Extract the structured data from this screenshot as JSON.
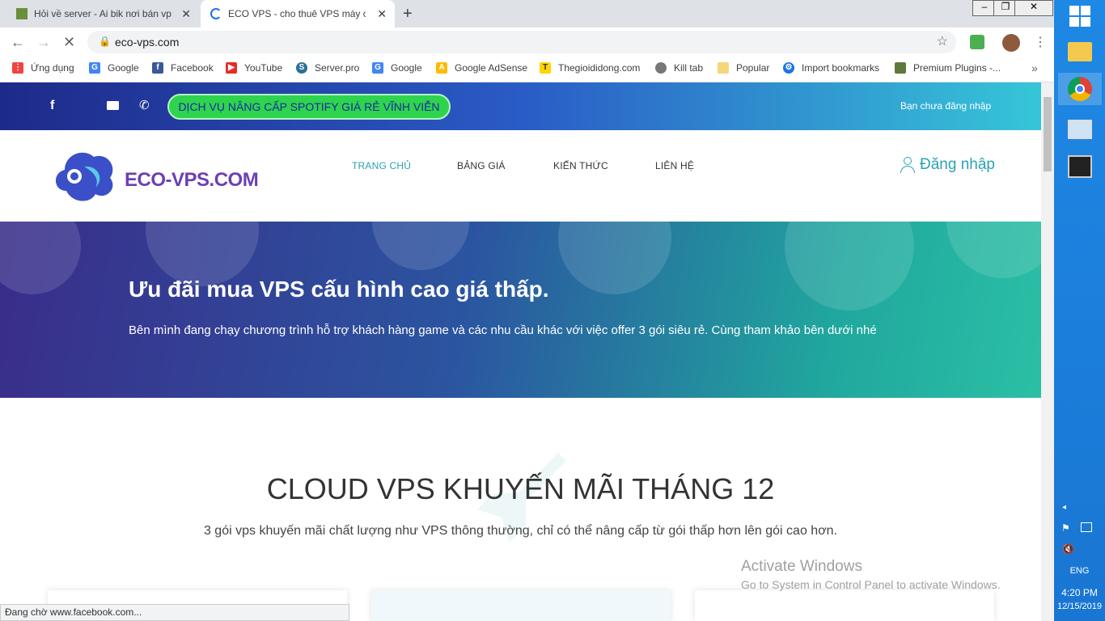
{
  "browser": {
    "tabs": [
      {
        "title": "Hỏi về server - Ai bik nơi bán vps",
        "active": false
      },
      {
        "title": "ECO VPS - cho thuê VPS máy chủ",
        "active": true
      }
    ],
    "url": "eco-vps.com",
    "bookmarks": [
      {
        "label": "Ứng dụng",
        "icon": "apps-grid-icon"
      },
      {
        "label": "Google",
        "icon": "google-icon"
      },
      {
        "label": "Facebook",
        "icon": "facebook-icon"
      },
      {
        "label": "YouTube",
        "icon": "youtube-icon"
      },
      {
        "label": "Server.pro",
        "icon": "serverpro-icon"
      },
      {
        "label": "Google",
        "icon": "google-icon"
      },
      {
        "label": "Google AdSense",
        "icon": "adsense-icon"
      },
      {
        "label": "Thegioididong.com",
        "icon": "tgdd-icon"
      },
      {
        "label": "Kill tab",
        "icon": "globe-icon"
      },
      {
        "label": "Popular",
        "icon": "folder-icon"
      },
      {
        "label": "Import bookmarks",
        "icon": "gear-icon"
      },
      {
        "label": "Premium Plugins -...",
        "icon": "plugin-icon"
      }
    ],
    "status": "Đang chờ www.facebook.com..."
  },
  "site": {
    "topbar": {
      "promo": "DỊCH VỤ NÂNG CẤP SPOTIFY GIÁ RẺ VĨNH VIỄN",
      "login_status": "Bạn chưa đăng nhập"
    },
    "logo_text": "ECO-VPS.COM",
    "menu": [
      "TRANG CHỦ",
      "BẢNG GIÁ",
      "KIẾN THỨC",
      "LIÊN HỆ"
    ],
    "login": "Đăng nhập",
    "hero": {
      "title": "Ưu đãi mua VPS cấu hình cao giá thấp.",
      "subtitle": "Bên mình đang chạy chương trình hỗ trợ khách hàng game và các nhu cầu khác với việc offer 3 gói siêu rẻ. Cùng tham khảo bên dưới nhé"
    },
    "section": {
      "title": "CLOUD VPS KHUYẾN MÃI THÁNG 12",
      "subtitle": "3 gói vps khuyến mãi chất lượng như VPS thông thường, chỉ có thể nâng cấp từ gói thấp hơn lên gói cao hơn."
    }
  },
  "windows": {
    "activate_title": "Activate Windows",
    "activate_sub": "Go to System in Control Panel to activate Windows.",
    "lang": "ENG",
    "time": "4:20 PM",
    "date": "12/15/2019"
  },
  "colors": {
    "accent_teal": "#29a3b3",
    "promo_green": "#2fd44e"
  }
}
